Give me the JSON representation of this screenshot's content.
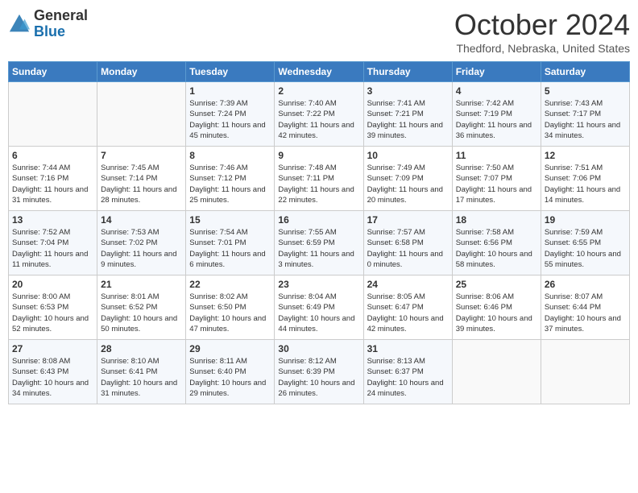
{
  "header": {
    "logo_general": "General",
    "logo_blue": "Blue",
    "month_title": "October 2024",
    "location": "Thedford, Nebraska, United States"
  },
  "weekdays": [
    "Sunday",
    "Monday",
    "Tuesday",
    "Wednesday",
    "Thursday",
    "Friday",
    "Saturday"
  ],
  "weeks": [
    [
      {
        "day": "",
        "content": ""
      },
      {
        "day": "",
        "content": ""
      },
      {
        "day": "1",
        "content": "Sunrise: 7:39 AM\nSunset: 7:24 PM\nDaylight: 11 hours and 45 minutes."
      },
      {
        "day": "2",
        "content": "Sunrise: 7:40 AM\nSunset: 7:22 PM\nDaylight: 11 hours and 42 minutes."
      },
      {
        "day": "3",
        "content": "Sunrise: 7:41 AM\nSunset: 7:21 PM\nDaylight: 11 hours and 39 minutes."
      },
      {
        "day": "4",
        "content": "Sunrise: 7:42 AM\nSunset: 7:19 PM\nDaylight: 11 hours and 36 minutes."
      },
      {
        "day": "5",
        "content": "Sunrise: 7:43 AM\nSunset: 7:17 PM\nDaylight: 11 hours and 34 minutes."
      }
    ],
    [
      {
        "day": "6",
        "content": "Sunrise: 7:44 AM\nSunset: 7:16 PM\nDaylight: 11 hours and 31 minutes."
      },
      {
        "day": "7",
        "content": "Sunrise: 7:45 AM\nSunset: 7:14 PM\nDaylight: 11 hours and 28 minutes."
      },
      {
        "day": "8",
        "content": "Sunrise: 7:46 AM\nSunset: 7:12 PM\nDaylight: 11 hours and 25 minutes."
      },
      {
        "day": "9",
        "content": "Sunrise: 7:48 AM\nSunset: 7:11 PM\nDaylight: 11 hours and 22 minutes."
      },
      {
        "day": "10",
        "content": "Sunrise: 7:49 AM\nSunset: 7:09 PM\nDaylight: 11 hours and 20 minutes."
      },
      {
        "day": "11",
        "content": "Sunrise: 7:50 AM\nSunset: 7:07 PM\nDaylight: 11 hours and 17 minutes."
      },
      {
        "day": "12",
        "content": "Sunrise: 7:51 AM\nSunset: 7:06 PM\nDaylight: 11 hours and 14 minutes."
      }
    ],
    [
      {
        "day": "13",
        "content": "Sunrise: 7:52 AM\nSunset: 7:04 PM\nDaylight: 11 hours and 11 minutes."
      },
      {
        "day": "14",
        "content": "Sunrise: 7:53 AM\nSunset: 7:02 PM\nDaylight: 11 hours and 9 minutes."
      },
      {
        "day": "15",
        "content": "Sunrise: 7:54 AM\nSunset: 7:01 PM\nDaylight: 11 hours and 6 minutes."
      },
      {
        "day": "16",
        "content": "Sunrise: 7:55 AM\nSunset: 6:59 PM\nDaylight: 11 hours and 3 minutes."
      },
      {
        "day": "17",
        "content": "Sunrise: 7:57 AM\nSunset: 6:58 PM\nDaylight: 11 hours and 0 minutes."
      },
      {
        "day": "18",
        "content": "Sunrise: 7:58 AM\nSunset: 6:56 PM\nDaylight: 10 hours and 58 minutes."
      },
      {
        "day": "19",
        "content": "Sunrise: 7:59 AM\nSunset: 6:55 PM\nDaylight: 10 hours and 55 minutes."
      }
    ],
    [
      {
        "day": "20",
        "content": "Sunrise: 8:00 AM\nSunset: 6:53 PM\nDaylight: 10 hours and 52 minutes."
      },
      {
        "day": "21",
        "content": "Sunrise: 8:01 AM\nSunset: 6:52 PM\nDaylight: 10 hours and 50 minutes."
      },
      {
        "day": "22",
        "content": "Sunrise: 8:02 AM\nSunset: 6:50 PM\nDaylight: 10 hours and 47 minutes."
      },
      {
        "day": "23",
        "content": "Sunrise: 8:04 AM\nSunset: 6:49 PM\nDaylight: 10 hours and 44 minutes."
      },
      {
        "day": "24",
        "content": "Sunrise: 8:05 AM\nSunset: 6:47 PM\nDaylight: 10 hours and 42 minutes."
      },
      {
        "day": "25",
        "content": "Sunrise: 8:06 AM\nSunset: 6:46 PM\nDaylight: 10 hours and 39 minutes."
      },
      {
        "day": "26",
        "content": "Sunrise: 8:07 AM\nSunset: 6:44 PM\nDaylight: 10 hours and 37 minutes."
      }
    ],
    [
      {
        "day": "27",
        "content": "Sunrise: 8:08 AM\nSunset: 6:43 PM\nDaylight: 10 hours and 34 minutes."
      },
      {
        "day": "28",
        "content": "Sunrise: 8:10 AM\nSunset: 6:41 PM\nDaylight: 10 hours and 31 minutes."
      },
      {
        "day": "29",
        "content": "Sunrise: 8:11 AM\nSunset: 6:40 PM\nDaylight: 10 hours and 29 minutes."
      },
      {
        "day": "30",
        "content": "Sunrise: 8:12 AM\nSunset: 6:39 PM\nDaylight: 10 hours and 26 minutes."
      },
      {
        "day": "31",
        "content": "Sunrise: 8:13 AM\nSunset: 6:37 PM\nDaylight: 10 hours and 24 minutes."
      },
      {
        "day": "",
        "content": ""
      },
      {
        "day": "",
        "content": ""
      }
    ]
  ]
}
